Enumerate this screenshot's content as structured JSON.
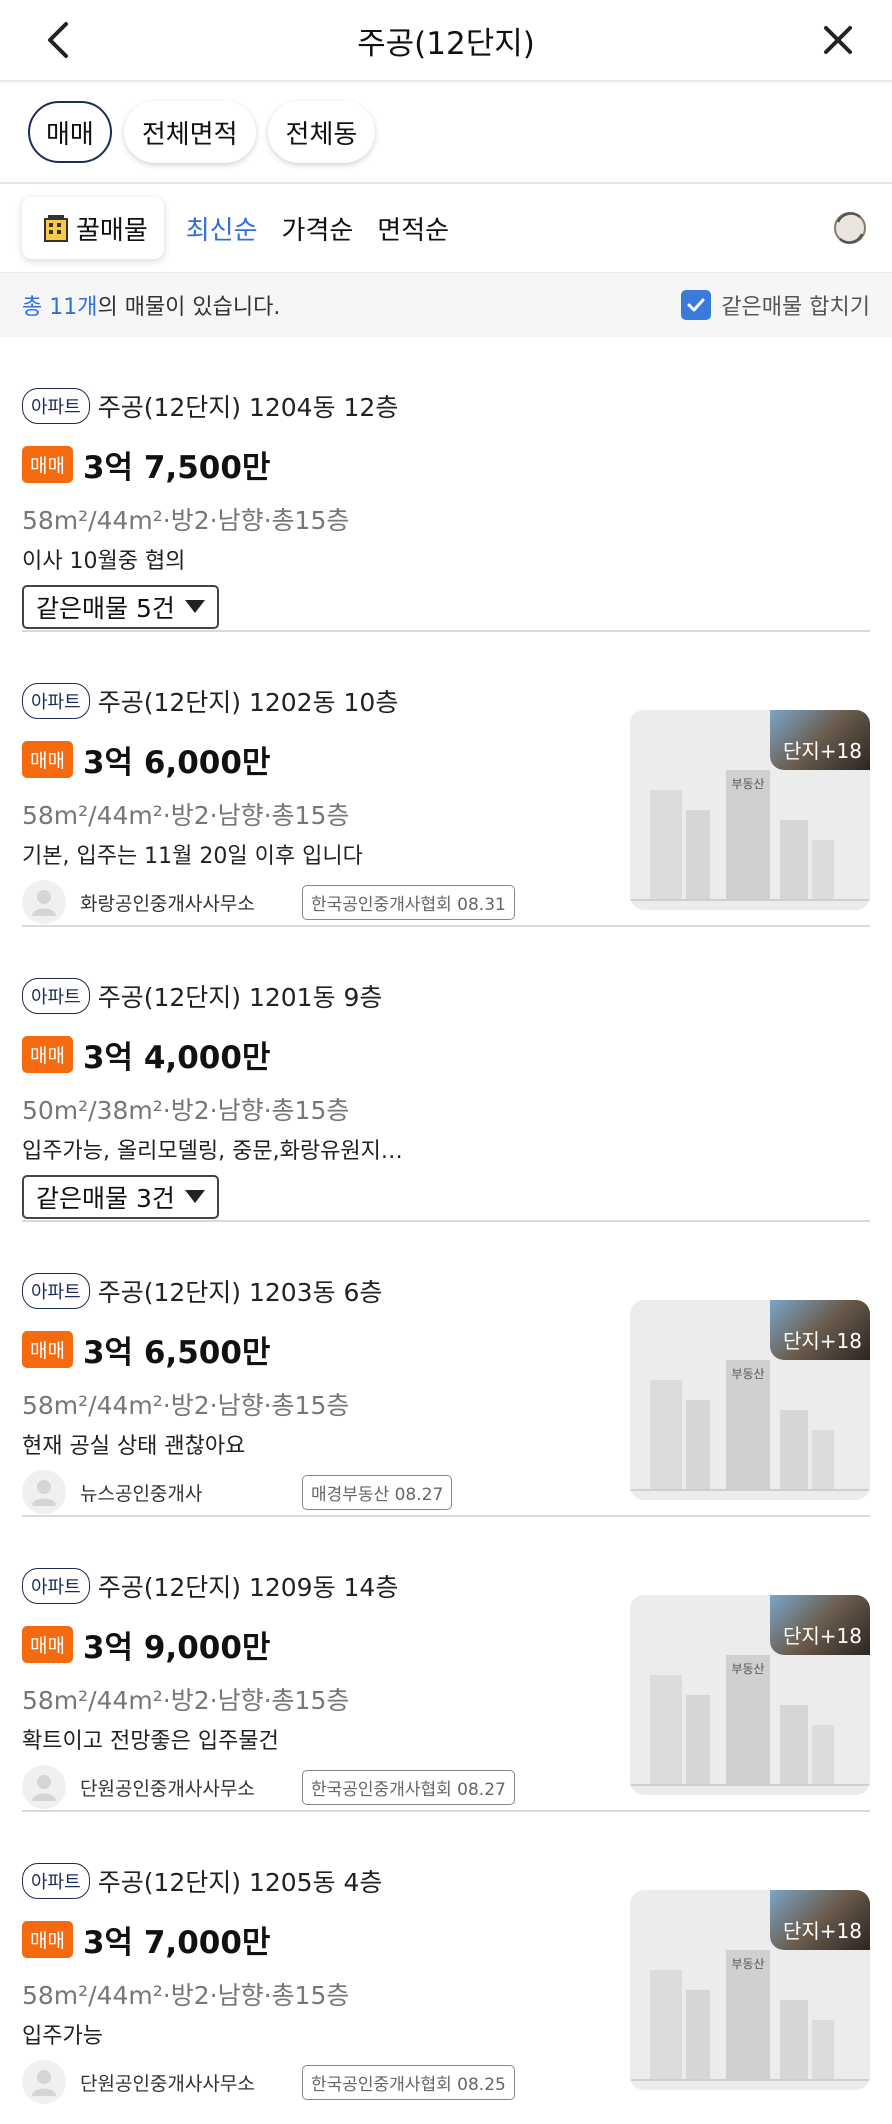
{
  "header": {
    "title": "주공(12단지)",
    "back_icon": "chevron-left-icon",
    "close_icon": "close-icon"
  },
  "filters": [
    "매매",
    "전체면적",
    "전체동"
  ],
  "sortbar": {
    "honey_label": "꿀매물",
    "options": [
      "최신순",
      "가격순",
      "면적순"
    ],
    "active": "최신순",
    "unit_icon": "평"
  },
  "summary": {
    "count_text": "총 11개",
    "suffix": "의 매물이 있습니다.",
    "merge_label": "같은매물 합치기",
    "merge_checked": true
  },
  "colors": {
    "accent": "#2f6fdb",
    "deal": "#f5690f",
    "navy": "#1c2b5a"
  },
  "listings": [
    {
      "type": "아파트",
      "name": "주공(12단지) 1204동 12층",
      "deal": "매매",
      "price": "3억 7,500만",
      "spec": "58m²/44m²·방2·남향·총15층",
      "desc": "이사 10월중 협의",
      "same": "같은매물 5건"
    },
    {
      "type": "아파트",
      "name": "주공(12단지) 1202동 10층",
      "deal": "매매",
      "price": "3억 6,000만",
      "spec": "58m²/44m²·방2·남향·총15층",
      "desc": "기본, 입주는 11월 20일 이후 입니다",
      "agent": "화랑공인중개사사무소",
      "source": "한국공인중개사협회 08.31",
      "thumb_tag": "단지+18",
      "thumb_logo": "부동산"
    },
    {
      "type": "아파트",
      "name": "주공(12단지) 1201동 9층",
      "deal": "매매",
      "price": "3억 4,000만",
      "spec": "50m²/38m²·방2·남향·총15층",
      "desc": "입주가능, 올리모델링, 중문,화랑유원지…",
      "same": "같은매물 3건"
    },
    {
      "type": "아파트",
      "name": "주공(12단지) 1203동 6층",
      "deal": "매매",
      "price": "3억 6,500만",
      "spec": "58m²/44m²·방2·남향·총15층",
      "desc": "현재 공실 상태 괜찮아요",
      "agent": "뉴스공인중개사",
      "source": "매경부동산 08.27",
      "thumb_tag": "단지+18",
      "thumb_logo": "부동산"
    },
    {
      "type": "아파트",
      "name": "주공(12단지) 1209동 14층",
      "deal": "매매",
      "price": "3억 9,000만",
      "spec": "58m²/44m²·방2·남향·총15층",
      "desc": "확트이고 전망좋은 입주물건",
      "agent": "단원공인중개사사무소",
      "source": "한국공인중개사협회 08.27",
      "thumb_tag": "단지+18",
      "thumb_logo": "부동산"
    },
    {
      "type": "아파트",
      "name": "주공(12단지) 1205동 4층",
      "deal": "매매",
      "price": "3억 7,000만",
      "spec": "58m²/44m²·방2·남향·총15층",
      "desc": "입주가능",
      "agent": "단원공인중개사사무소",
      "source": "한국공인중개사협회 08.25",
      "thumb_tag": "단지+18",
      "thumb_logo": "부동산"
    }
  ]
}
